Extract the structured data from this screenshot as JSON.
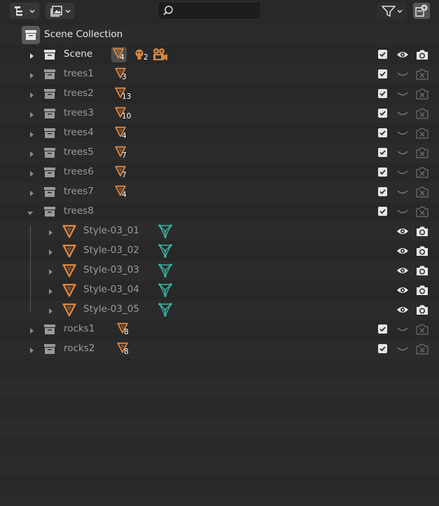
{
  "search": {
    "value": "",
    "placeholder": ""
  },
  "scene_collection": {
    "label": "Scene Collection"
  },
  "scene": {
    "label": "Scene",
    "object_count": "4",
    "light_count": "2"
  },
  "collections": [
    {
      "label": "trees1",
      "count": "3"
    },
    {
      "label": "trees2",
      "count": "13"
    },
    {
      "label": "trees3",
      "count": "10"
    },
    {
      "label": "trees4",
      "count": "4"
    },
    {
      "label": "trees5",
      "count": "7"
    },
    {
      "label": "trees6",
      "count": "7"
    },
    {
      "label": "trees7",
      "count": "4"
    }
  ],
  "trees8": {
    "label": "trees8",
    "children": [
      {
        "label": "Style-03_01"
      },
      {
        "label": "Style-03_02"
      },
      {
        "label": "Style-03_03"
      },
      {
        "label": "Style-03_04"
      },
      {
        "label": "Style-03_05"
      }
    ]
  },
  "rocks": [
    {
      "label": "rocks1",
      "count": "8"
    },
    {
      "label": "rocks2",
      "count": "8"
    }
  ],
  "colors": {
    "object_orange": "#d9853f",
    "mesh_teal": "#38b2a6",
    "background": "#282828"
  },
  "icons": {
    "display_mode": "outliner-display-mode-icon",
    "filter": "filter-icon",
    "new_collection": "new-collection-icon"
  }
}
